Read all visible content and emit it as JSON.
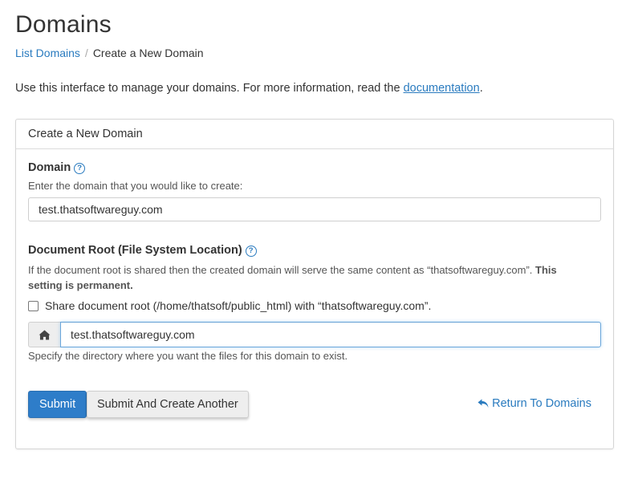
{
  "page": {
    "title": "Domains",
    "breadcrumb": {
      "link": "List Domains",
      "separator": "/",
      "current": "Create a New Domain"
    },
    "intro_text": "Use this interface to manage your domains. For more information, read the ",
    "intro_link": "documentation",
    "intro_end": "."
  },
  "panel": {
    "heading": "Create a New Domain",
    "domain": {
      "label": "Domain",
      "help_glyph": "?",
      "help_text": "Enter the domain that you would like to create:",
      "value": "test.thatsoftwareguy.com"
    },
    "docroot": {
      "label": "Document Root (File System Location)",
      "help_glyph": "?",
      "help_text": "If the document root is shared then the created domain will serve the same content as “thatsoftwareguy.com”. ",
      "help_bold_1": "This",
      "help_bold_2": "setting is permanent.",
      "share_label": "Share document root (/home/thatsoft/public_html) with “thatsoftwareguy.com”.",
      "share_checked": false,
      "addon_icon": "home-icon",
      "value": "test.thatsoftwareguy.com",
      "specify_text": "Specify the directory where you want the files for this domain to exist."
    },
    "buttons": {
      "submit": "Submit",
      "submit_another": "Submit And Create Another",
      "return": "Return To Domains"
    }
  },
  "colors": {
    "accent": "#2a7bbf",
    "primary_button": "#2e7dc9",
    "focus_border": "#6aa6db"
  }
}
